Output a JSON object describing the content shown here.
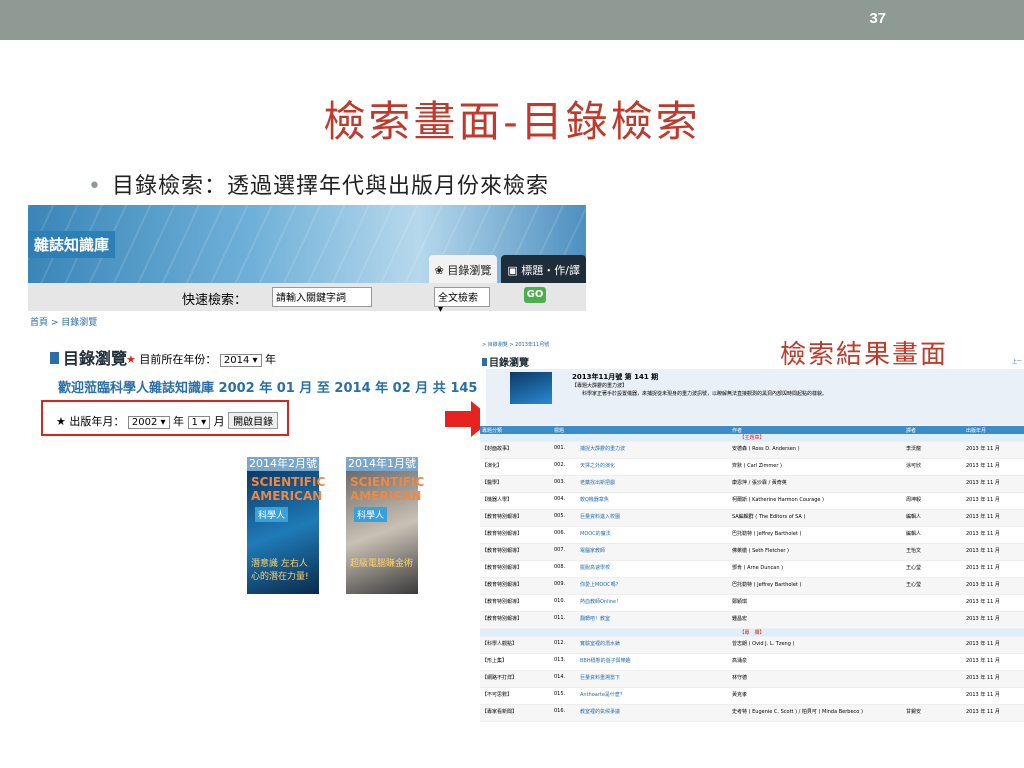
{
  "slide": {
    "page_number": "37",
    "title": "檢索畫面-目錄檢索",
    "bullet": "目錄檢索：透過選擇年代與出版月份來檢索"
  },
  "left_screenshot": {
    "site_name": "雜誌知識庫",
    "tabs": [
      "目錄瀏覽",
      "標題・作/譯"
    ],
    "search_label": "快速檢索：",
    "search_placeholder": "請輸入關鍵字詞",
    "search_scope": "全文檢索",
    "go_label": "GO",
    "breadcrumb": "首頁 > 目錄瀏覽",
    "section_title": "目錄瀏覽",
    "year_label": "目前所在年份：",
    "year_value": "2014",
    "year_unit": "年",
    "welcome": "歡迎蒞臨科學人雜誌知識庫 2002 年 01 月  至  2014 年 02 月  共 145 期",
    "pub_label": "出版年月：",
    "pub_year": "2002",
    "pub_year_unit": "年",
    "pub_month": "1",
    "pub_month_unit": "月",
    "open_button": "開啟目錄",
    "covers": [
      {
        "label": "2014年2月號",
        "mag": "SCIENTIFIC AMERICAN",
        "badge": "科學人",
        "text": "潛意識 左右人心的潛在力量!"
      },
      {
        "label": "2014年1月號",
        "mag": "SCIENTIFIC AMERICAN",
        "badge": "科學人",
        "text": "超級電腦賺金術"
      }
    ]
  },
  "right_screenshot": {
    "result_title": "檢索結果畫面",
    "breadcrumb": "> 目錄瀏覽 > 2013年11月號",
    "section_title": "目錄瀏覽",
    "prev": "上一",
    "issue_heading": "2013年11月號   第 141 期",
    "issue_sub": "【專題大霹靂的重力波】",
    "issue_desc": "科學家正著手於設置儀器，來捕捉從未現身的重力波訊號，以瞭解無法直接觀測的黑洞內部與時間起點的樣貌。",
    "columns": [
      "專題分類",
      "標題",
      "",
      "作者",
      "譯者",
      "出版年月"
    ],
    "rows": [
      {
        "type": "cat",
        "text": "【主題章】"
      },
      {
        "cat": "【封面故事】",
        "no": "001.",
        "title": "捕捉大霹靂的重力波",
        "author": "安德森 ( Ross D. Andersen )",
        "translator": "李沃龍",
        "date": "2013 年 11 月"
      },
      {
        "cat": "【演化】",
        "no": "002.",
        "title": "天擇之外的演化",
        "author": "齊默 ( Carl Zimmer )",
        "translator": "涂可欣",
        "date": "2013 年 11 月"
      },
      {
        "cat": "【醫學】",
        "no": "003.",
        "title": "老藥找出新把戲",
        "author": "康恩萍 / 張沙霖 / 黃奇英",
        "translator": "",
        "date": "2013 年 11 月"
      },
      {
        "cat": "【機器人學】",
        "no": "004.",
        "title": "軟Q機器章魚",
        "author": "柯爾斯 ( Katherine Harmon Courage )",
        "translator": "周坤毅",
        "date": "2013 年 11 月"
      },
      {
        "cat": "【教育特別報導】",
        "no": "005.",
        "title": "巨量資料進入校園",
        "author": "SA編輯群 ( The Editors of SA )",
        "translator": "編輯人",
        "date": "2013 年 11 月"
      },
      {
        "cat": "【教育特別報導】",
        "no": "006.",
        "title": "MOOC的魔法",
        "author": "巴托勒特 ( Jeffrey Bartholet )",
        "translator": "編輯人",
        "date": "2013 年 11 月"
      },
      {
        "cat": "【教育特別報導】",
        "no": "007.",
        "title": "電腦家教師",
        "author": "佛萊徹 ( Seth Fletcher )",
        "translator": "王怡文",
        "date": "2013 年 11 月"
      },
      {
        "cat": "【教育特別報導】",
        "no": "008.",
        "title": "擺脫高速學校",
        "author": "鄧肯 ( Arne Duncan )",
        "translator": "王心瑩",
        "date": "2013 年 11 月"
      },
      {
        "cat": "【教育特別報導】",
        "no": "009.",
        "title": "你愛上MOOC嗎？",
        "author": "巴托勒特 ( Jeffrey Bartholet )",
        "translator": "王心瑩",
        "date": "2013 年 11 月"
      },
      {
        "cat": "【教育特別報導】",
        "no": "010.",
        "title": "熱血教師Online！",
        "author": "鄭穎琪",
        "translator": "",
        "date": "2013 年 11 月"
      },
      {
        "cat": "【教育特別報導】",
        "no": "011.",
        "title": "翻轉吧！教室",
        "author": "鍾昌宏",
        "translator": "",
        "date": "2013 年 11 月"
      },
      {
        "type": "cat",
        "text": "【專　欄】"
      },
      {
        "cat": "【科學人觀點】",
        "no": "012.",
        "title": "實驗室裡的潛水錶",
        "author": "曾志朗 ( Ovid J. L. Tzeng )",
        "translator": "",
        "date": "2013 年 11 月"
      },
      {
        "cat": "【形上集】",
        "no": "013.",
        "title": "BBH穩態的遊子與樂趣",
        "author": "高涌泉",
        "translator": "",
        "date": "2013 年 11 月"
      },
      {
        "cat": "【網路不打烊】",
        "no": "014.",
        "title": "巨量資料重溯當下",
        "author": "林守德",
        "translator": "",
        "date": "2013 年 11 月"
      },
      {
        "cat": "【不可思數】",
        "no": "015.",
        "title": "Anthoarte是什麼？",
        "author": "黃克孝",
        "translator": "",
        "date": "2013 年 11 月"
      },
      {
        "cat": "【專家看新聞】",
        "no": "016.",
        "title": "教室裡的氣候爭議",
        "author": "史考特 ( Eugenie C. Scott ) / 柏貝可 ( Minda Berbeco )",
        "translator": "甘錫安",
        "date": "2013 年 11 月"
      }
    ]
  },
  "colors": {
    "accent_red": "#c0392b",
    "topbar": "#8e9a93",
    "link_blue": "#2a6fa8",
    "table_header": "#3b8cc9"
  }
}
